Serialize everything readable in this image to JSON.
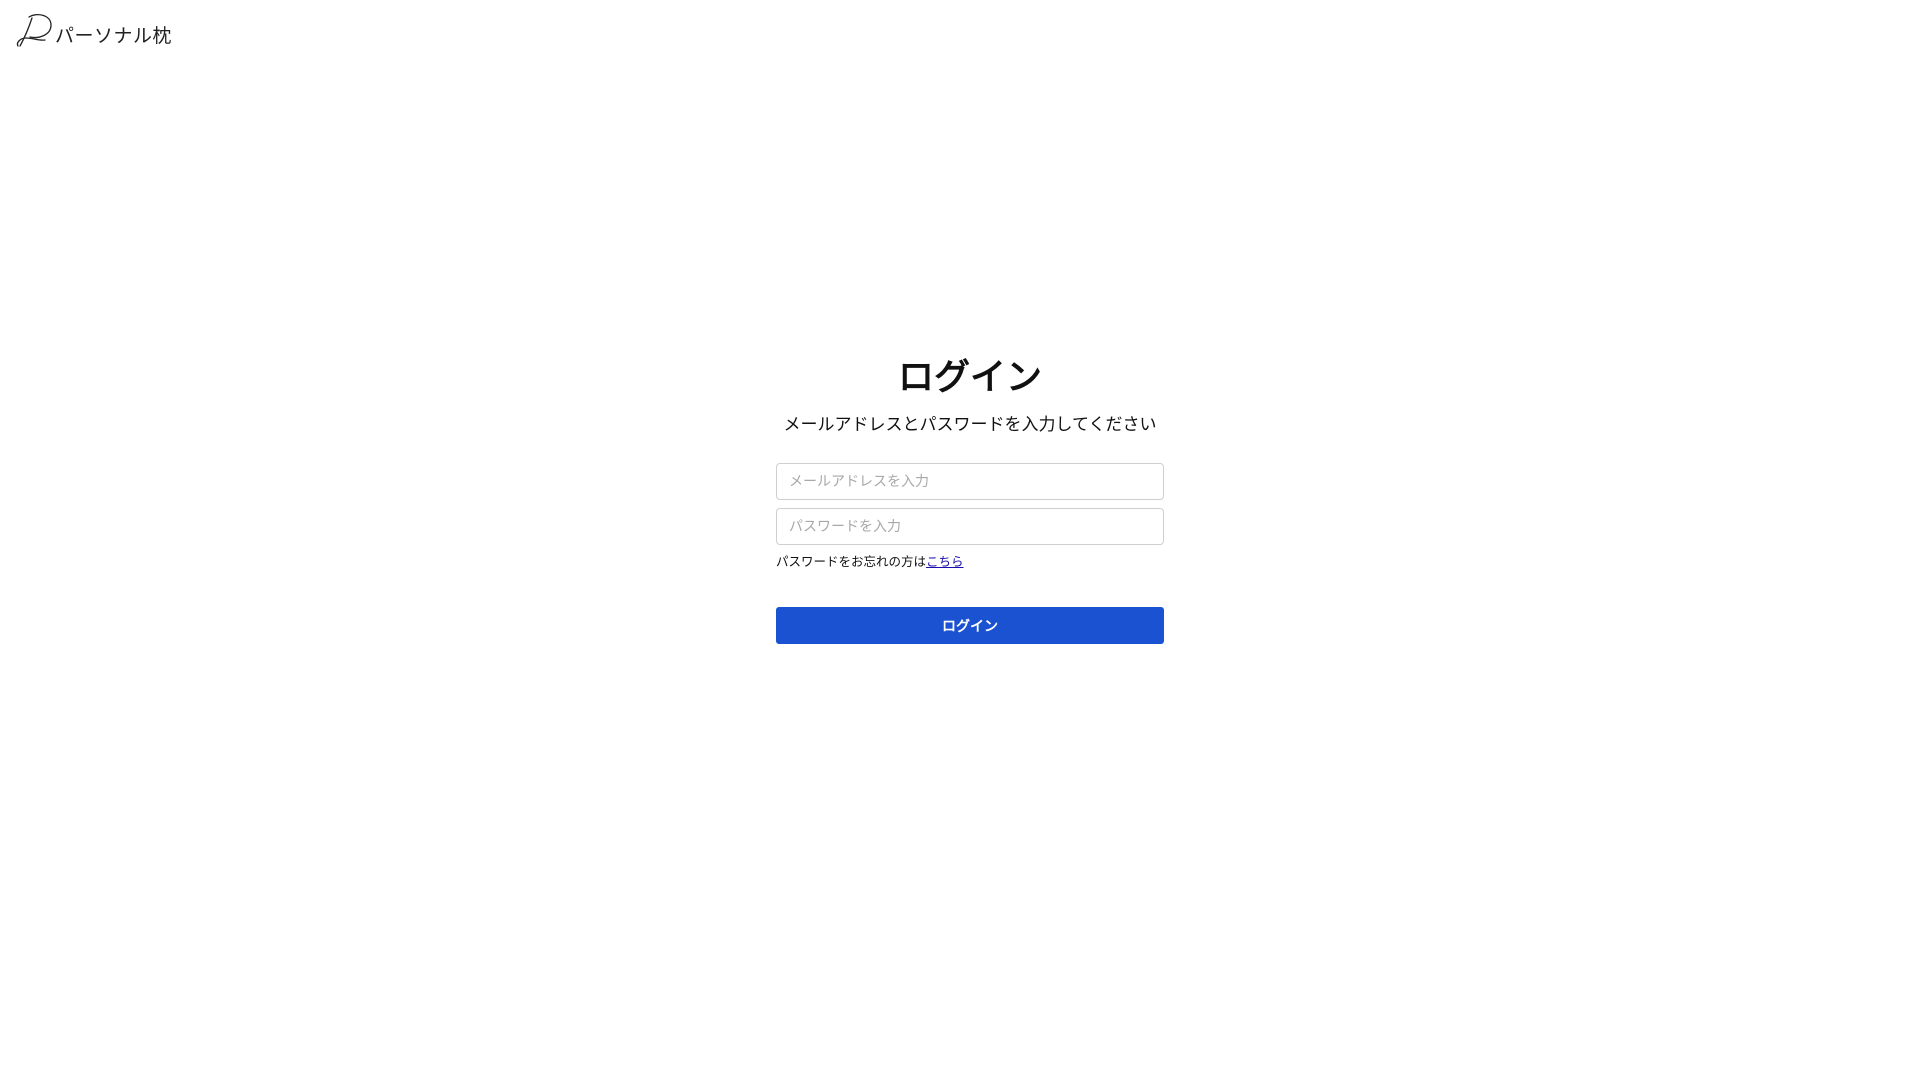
{
  "brand": {
    "logo_icon": "pillow-script-logo-icon",
    "name": "パーソナル枕"
  },
  "login": {
    "title": "ログイン",
    "subtitle": "メールアドレスとパスワードを入力してください",
    "email_placeholder": "メールアドレスを入力",
    "email_value": "",
    "password_placeholder": "パスワードを入力",
    "password_value": "",
    "forgot_text": "パスワードをお忘れの方は",
    "forgot_link": "こちら",
    "submit_label": "ログイン"
  },
  "colors": {
    "primary_button": "#1a52d1",
    "link": "#1a0dab",
    "input_border": "#cfcfcf"
  }
}
